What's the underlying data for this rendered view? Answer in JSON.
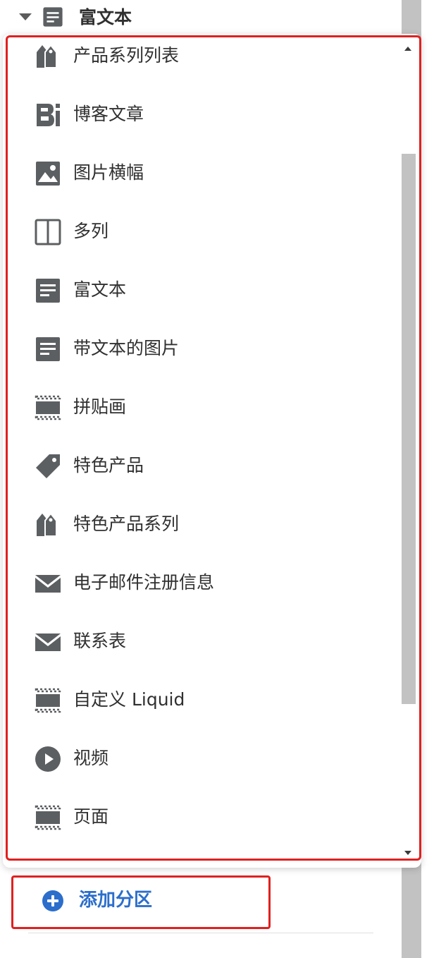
{
  "header": {
    "title": "富文本",
    "icon": "text-block-icon"
  },
  "section_list": {
    "items": [
      {
        "label": "产品系列列表",
        "icon": "collection-icon"
      },
      {
        "label": "博客文章",
        "icon": "blog-icon"
      },
      {
        "label": "图片横幅",
        "icon": "image-icon"
      },
      {
        "label": "多列",
        "icon": "columns-icon"
      },
      {
        "label": "富文本",
        "icon": "text-block-icon"
      },
      {
        "label": "带文本的图片",
        "icon": "text-block-icon"
      },
      {
        "label": "拼贴画",
        "icon": "collage-icon"
      },
      {
        "label": "特色产品",
        "icon": "tag-icon"
      },
      {
        "label": "特色产品系列",
        "icon": "collection-icon"
      },
      {
        "label": "电子邮件注册信息",
        "icon": "email-icon"
      },
      {
        "label": "联系表",
        "icon": "email-icon"
      },
      {
        "label": "自定义 Liquid",
        "icon": "collage-icon"
      },
      {
        "label": "视频",
        "icon": "play-icon"
      },
      {
        "label": "页面",
        "icon": "collage-icon"
      }
    ]
  },
  "add_section": {
    "label": "添加分区",
    "icon": "plus-circle-icon"
  },
  "colors": {
    "highlight": "#e02020",
    "accent": "#2c6ecb",
    "icon": "#5c5f62",
    "text": "#303030"
  }
}
